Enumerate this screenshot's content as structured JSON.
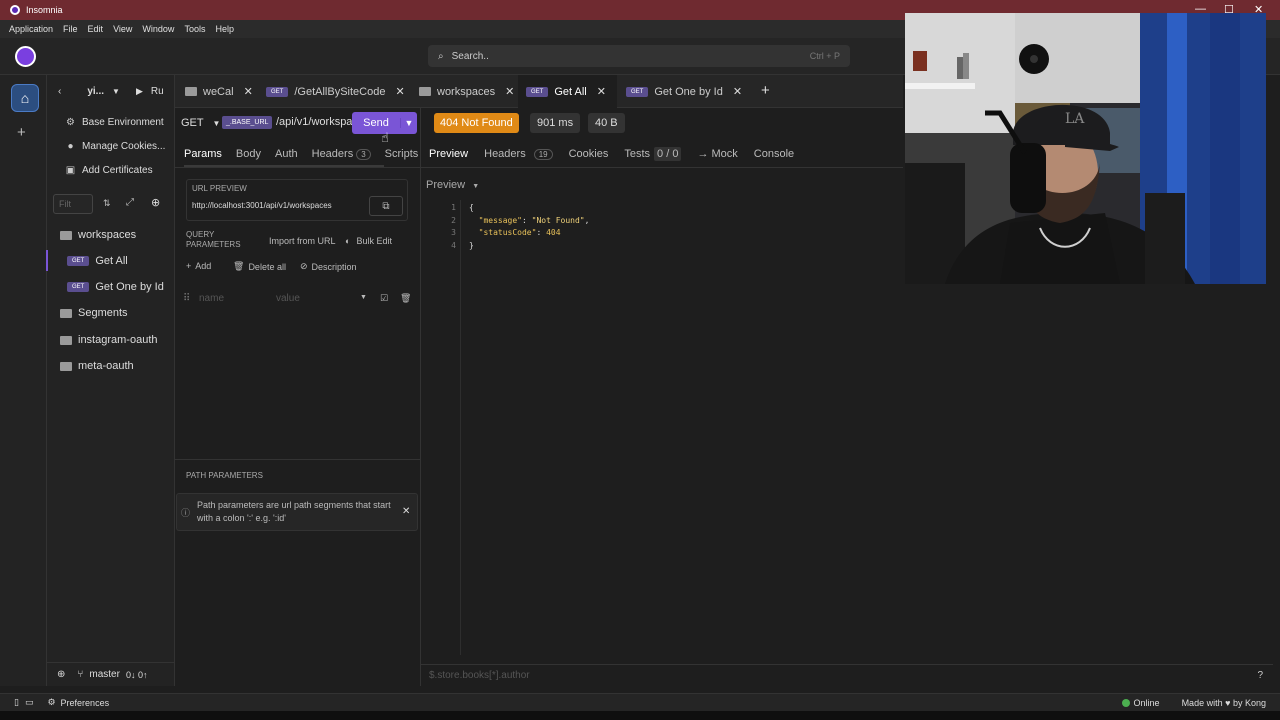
{
  "window": {
    "title": "Insomnia"
  },
  "menu": [
    "Application",
    "File",
    "Edit",
    "View",
    "Window",
    "Tools",
    "Help"
  ],
  "search": {
    "placeholder": "Search..",
    "shortcut": "Ctrl + P"
  },
  "sidebar": {
    "project": "yi...",
    "run_label": "Ru",
    "links": [
      "Base Environment",
      "Manage Cookies...",
      "Add Certificates"
    ],
    "filter_placeholder": "Filt",
    "tree": {
      "folder": "workspaces",
      "requests": [
        {
          "method": "GET",
          "name": "Get All"
        },
        {
          "method": "GET",
          "name": "Get One by Id"
        }
      ],
      "other_folders": [
        "Segments",
        "instagram-oauth",
        "meta-oauth"
      ]
    },
    "branch": "master",
    "sync": "0↓ 0↑"
  },
  "tabs": [
    {
      "type": "folder",
      "label": "weCal"
    },
    {
      "type": "request",
      "method": "GET",
      "label": "/GetAllBySiteCode"
    },
    {
      "type": "folder",
      "label": "workspaces"
    },
    {
      "type": "request",
      "method": "GET",
      "label": "Get All",
      "active": true
    },
    {
      "type": "request",
      "method": "GET",
      "label": "Get One by Id"
    }
  ],
  "request": {
    "method": "GET",
    "base_tag": "_.BASE_URL",
    "path": "/api/v1/workspaces",
    "send_label": "Send",
    "tabs": {
      "params": "Params",
      "body": "Body",
      "auth": "Auth",
      "headers": "Headers",
      "headers_count": "3",
      "scripts": "Scripts"
    },
    "url_preview_label": "URL PREVIEW",
    "url_preview": "http://localhost:3001/api/v1/workspaces",
    "query_label_1": "QUERY",
    "query_label_2": "PARAMETERS",
    "import_from_url": "Import from URL",
    "bulk_edit": "Bulk Edit",
    "add": "Add",
    "delete_all": "Delete all",
    "description": "Description",
    "param_name_placeholder": "name",
    "param_value_placeholder": "value",
    "path_params_label": "PATH PARAMETERS",
    "path_params_note": "Path parameters are url path segments that start with a colon ':' e.g. ':id'"
  },
  "response": {
    "status": "404 Not Found",
    "time": "901 ms",
    "size": "40 B",
    "tabs": {
      "preview": "Preview",
      "headers": "Headers",
      "headers_count": "19",
      "cookies": "Cookies",
      "tests": "Tests",
      "tests_count": "0 / 0",
      "mock": "→ Mock",
      "console": "Console"
    },
    "preview_mode": "Preview",
    "body_lines": [
      {
        "n": "1",
        "text": "{"
      },
      {
        "n": "2",
        "key": "\"message\"",
        "value": "\"Not Found\"",
        "trail": ","
      },
      {
        "n": "3",
        "key": "\"statusCode\"",
        "value": "404",
        "trail": ""
      },
      {
        "n": "4",
        "text": "}"
      }
    ],
    "filter_placeholder": "$.store.books[*].author"
  },
  "statusbar": {
    "preferences": "Preferences",
    "online": "Online",
    "made_with": "Made with",
    "by": "by Kong"
  }
}
